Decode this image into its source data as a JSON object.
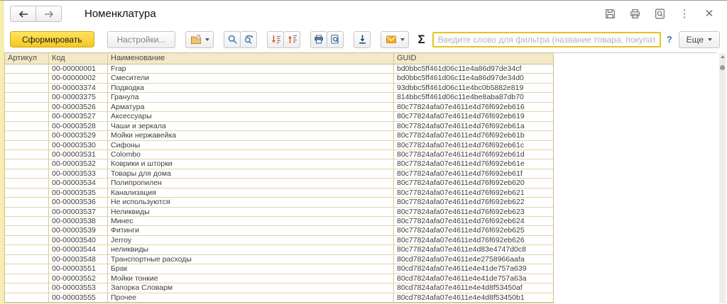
{
  "app": {
    "title": "Номенклатура"
  },
  "titlebar": {
    "nav_icons": [
      "back-arrow-icon",
      "forward-arrow-icon"
    ],
    "action_icons": [
      "save-icon",
      "print-icon",
      "find-icon",
      "kebab-menu-icon",
      "close-icon"
    ],
    "kebab_glyph": "⋮",
    "close_glyph": "✕"
  },
  "toolbar": {
    "generate_button": "Сформировать",
    "settings_button": "Настройки...",
    "icon_buttons": [
      "report-folder-icon",
      "search-icon",
      "search-next-icon",
      "sort-descending-icon",
      "sort-ascending-icon",
      "print-icon",
      "print-preview-icon",
      "download-icon",
      "email-icon"
    ],
    "sigma_glyph": "Σ",
    "filter_input": {
      "value": "",
      "placeholder": "Введите слово для фильтра (название товара, покупат..."
    },
    "help_button": "?",
    "more_button": "Еще"
  },
  "table": {
    "columns": [
      "Артикул",
      "Код",
      "Наименование",
      "GUID"
    ],
    "rows": [
      {
        "article": "",
        "code": "00-00000001",
        "name": "Frap",
        "guid": "bd0bbc5ff461d06c11e4a86d97de34cf"
      },
      {
        "article": "",
        "code": "00-00000002",
        "name": "Смесители",
        "guid": "bd0bbc5ff461d06c11e4a86d97de34d0"
      },
      {
        "article": "",
        "code": "00-00003374",
        "name": "Подводка",
        "guid": "93dbbc5ff461d06c11e4bc0b5882e819"
      },
      {
        "article": "",
        "code": "00-00003375",
        "name": "Гранула",
        "guid": "814bbc5ff461d06c11e4be8aba87db70"
      },
      {
        "article": "",
        "code": "00-00003526",
        "name": "Арматура",
        "guid": "80c77824afa07e4611e4d76f692eb616"
      },
      {
        "article": "",
        "code": "00-00003527",
        "name": "Аксессуары",
        "guid": "80c77824afa07e4611e4d76f692eb619"
      },
      {
        "article": "",
        "code": "00-00003528",
        "name": "Чаши и зеркала",
        "guid": "80c77824afa07e4611e4d76f692eb61a"
      },
      {
        "article": "",
        "code": "00-00003529",
        "name": "Мойки нержавейка",
        "guid": "80c77824afa07e4611e4d76f692eb61b"
      },
      {
        "article": "",
        "code": "00-00003530",
        "name": "Сифоны",
        "guid": "80c77824afa07e4611e4d76f692eb61c"
      },
      {
        "article": "",
        "code": "00-00003531",
        "name": "Colombo",
        "guid": "80c77824afa07e4611e4d76f692eb61d"
      },
      {
        "article": "",
        "code": "00-00003532",
        "name": "Коврики и шторки",
        "guid": "80c77824afa07e4611e4d76f692eb61e"
      },
      {
        "article": "",
        "code": "00-00003533",
        "name": "Товары для дома",
        "guid": "80c77824afa07e4611e4d76f692eb61f"
      },
      {
        "article": "",
        "code": "00-00003534",
        "name": "Полипропилен",
        "guid": "80c77824afa07e4611e4d76f692eb620"
      },
      {
        "article": "",
        "code": "00-00003535",
        "name": "Канализация",
        "guid": "80c77824afa07e4611e4d76f692eb621"
      },
      {
        "article": "",
        "code": "00-00003536",
        "name": "Не используются",
        "guid": "80c77824afa07e4611e4d76f692eb622"
      },
      {
        "article": "",
        "code": "00-00003537",
        "name": "Неликвиды",
        "guid": "80c77824afa07e4611e4d76f692eb623"
      },
      {
        "article": "",
        "code": "00-00003538",
        "name": "Минес",
        "guid": "80c77824afa07e4611e4d76f692eb624"
      },
      {
        "article": "",
        "code": "00-00003539",
        "name": "Фитинги",
        "guid": "80c77824afa07e4611e4d76f692eb625"
      },
      {
        "article": "",
        "code": "00-00003540",
        "name": "Jerroy",
        "guid": "80c77824afa07e4611e4d76f692eb626"
      },
      {
        "article": "",
        "code": "00-00003544",
        "name": "неликвиды",
        "guid": "80c77824afa07e4611e4d83e4747d0c8"
      },
      {
        "article": "",
        "code": "00-00003548",
        "name": "Транспортные расходы",
        "guid": "80cd7824afa07e4611e4e2758966aafa"
      },
      {
        "article": "",
        "code": "00-00003551",
        "name": "Брак",
        "guid": "80cd7824afa07e4611e4e41de757a639"
      },
      {
        "article": "",
        "code": "00-00003552",
        "name": "Мойки тонкие",
        "guid": "80cd7824afa07e4611e4e41de757a63a"
      },
      {
        "article": "",
        "code": "00-00003553",
        "name": "Запорка Словарм",
        "guid": "80cd7824afa07e4611e4e4d8f53450af"
      },
      {
        "article": "",
        "code": "00-00003555",
        "name": "Прочее",
        "guid": "80cd7824afa07e4611e4e4d8f53450b1"
      }
    ]
  },
  "colors": {
    "accent_yellow": "#f3c81f",
    "accent_border": "#cda90a",
    "header_bg": "#f3e9c8",
    "grid_border": "#d6c89c",
    "left_strip": "#f5eeb0",
    "filter_border": "#e7c11d",
    "help_blue": "#2f72c7"
  }
}
